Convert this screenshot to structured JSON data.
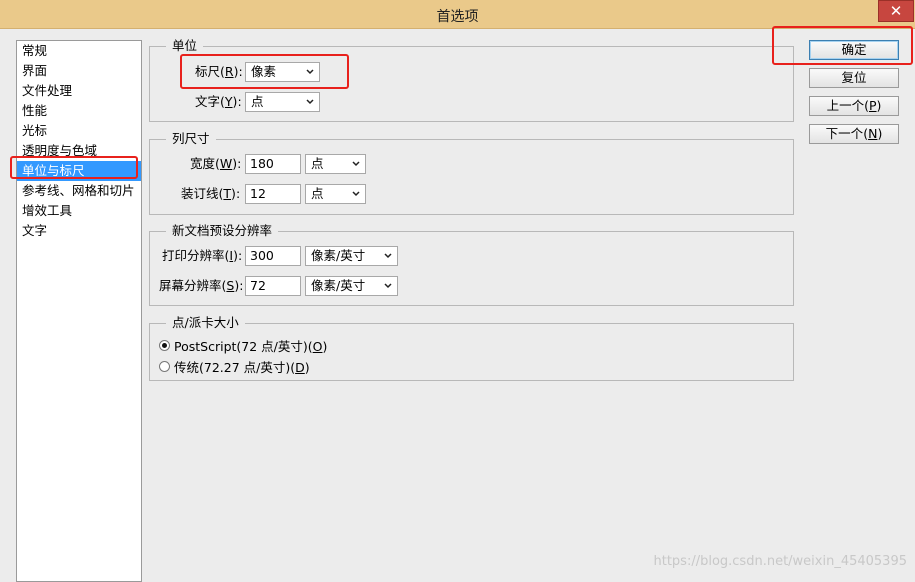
{
  "window": {
    "title": "首选项",
    "close_glyph": "✕"
  },
  "sidebar": {
    "items": [
      {
        "label": "常规",
        "selected": false
      },
      {
        "label": "界面",
        "selected": false
      },
      {
        "label": "文件处理",
        "selected": false
      },
      {
        "label": "性能",
        "selected": false
      },
      {
        "label": "光标",
        "selected": false
      },
      {
        "label": "透明度与色域",
        "selected": false
      },
      {
        "label": "单位与标尺",
        "selected": true
      },
      {
        "label": "参考线、网格和切片",
        "selected": false
      },
      {
        "label": "增效工具",
        "selected": false
      },
      {
        "label": "文字",
        "selected": false
      }
    ]
  },
  "units": {
    "title": "单位",
    "ruler": {
      "label": "标尺",
      "hotkey": "R",
      "suffix": ":",
      "value": "像素"
    },
    "type": {
      "label": "文字",
      "hotkey": "Y",
      "suffix": ":",
      "value": "点"
    }
  },
  "column_size": {
    "title": "列尺寸",
    "width": {
      "label": "宽度",
      "hotkey": "W",
      "suffix": ":",
      "value": "180",
      "unit": "点"
    },
    "gutter": {
      "label": "装订线",
      "hotkey": "T",
      "suffix": ":",
      "value": "12",
      "unit": "点"
    }
  },
  "new_doc_res": {
    "title": "新文档预设分辨率",
    "print": {
      "label": "打印分辨率",
      "hotkey": "I",
      "suffix": ":",
      "value": "300",
      "unit": "像素/英寸"
    },
    "screen": {
      "label": "屏幕分辨率",
      "hotkey": "S",
      "suffix": ":",
      "value": "72",
      "unit": "像素/英寸"
    }
  },
  "point_pica": {
    "title": "点/派卡大小",
    "postscript": {
      "label": "PostScript(72 点/英寸)",
      "hotkey": "O",
      "checked": true
    },
    "traditional": {
      "label": "传统(72.27 点/英寸)",
      "hotkey": "D",
      "checked": false
    }
  },
  "buttons": {
    "ok": "确定",
    "reset": "复位",
    "prev": {
      "label": "上一个",
      "hotkey": "P"
    },
    "next": {
      "label": "下一个",
      "hotkey": "N"
    }
  },
  "watermark": "https://blog.csdn.net/weixin_45405395",
  "colors": {
    "highlight": "#3399ff",
    "annotation": "#e8211c",
    "titlebar": "#eac98a"
  }
}
